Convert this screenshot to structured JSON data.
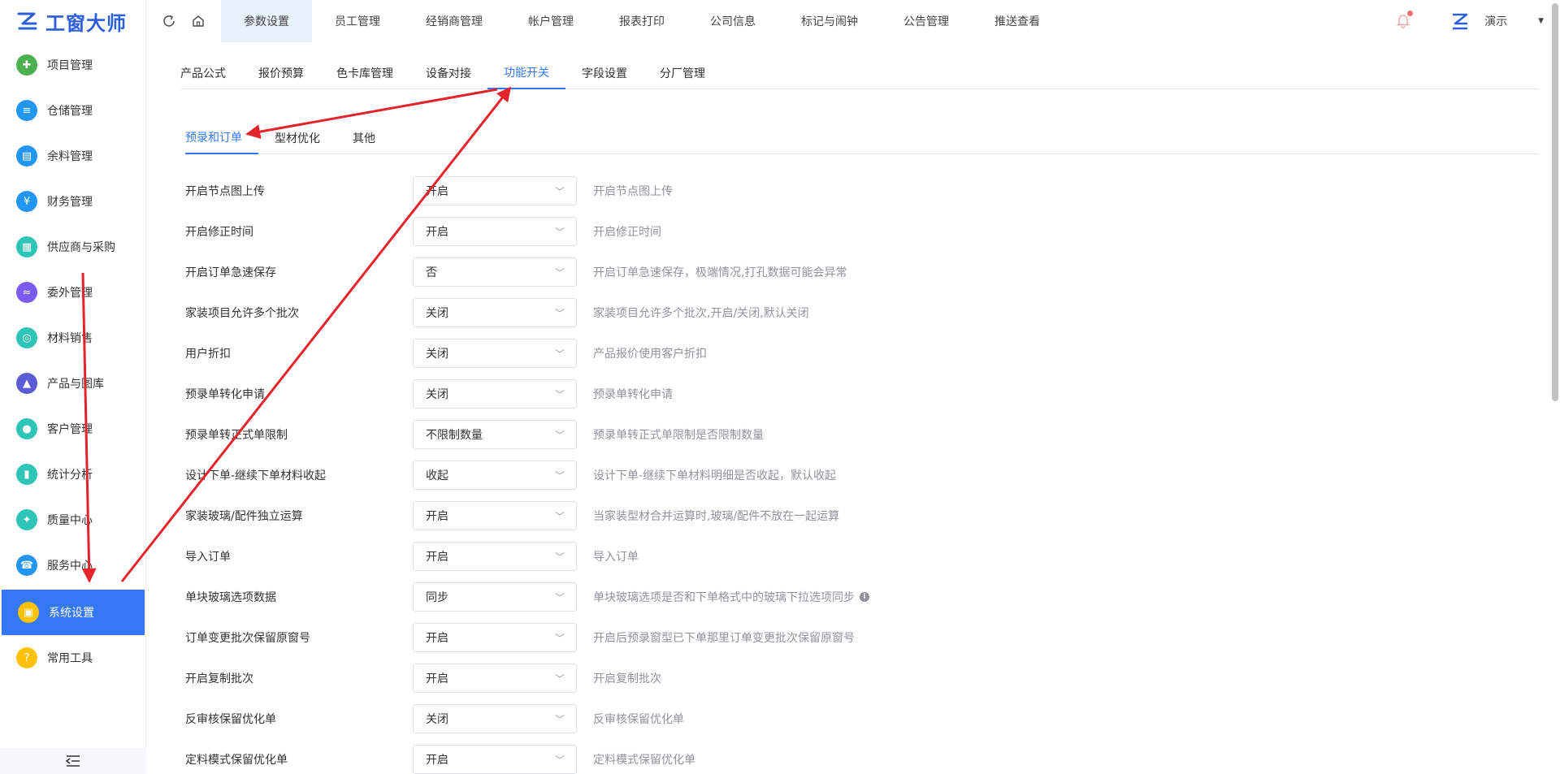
{
  "app": {
    "logo_text": "工窗大师"
  },
  "sidebar": {
    "items": [
      {
        "label": "项目管理",
        "icon": "puzzle-icon",
        "color": "#4caf50"
      },
      {
        "label": "仓储管理",
        "icon": "layers-icon",
        "color": "#2196f3"
      },
      {
        "label": "余料管理",
        "icon": "box-icon",
        "color": "#2196f3"
      },
      {
        "label": "财务管理",
        "icon": "finance-icon",
        "color": "#2196f3"
      },
      {
        "label": "供应商与采购",
        "icon": "document-icon",
        "color": "#2ec4b6"
      },
      {
        "label": "委外管理",
        "icon": "outsource-icon",
        "color": "#7c5cf0"
      },
      {
        "label": "材料销售",
        "icon": "sales-icon",
        "color": "#2ec4b6"
      },
      {
        "label": "产品与图库",
        "icon": "products-icon",
        "color": "#5b5bd6"
      },
      {
        "label": "客户管理",
        "icon": "user-icon",
        "color": "#2ec4b6"
      },
      {
        "label": "统计分析",
        "icon": "chart-icon",
        "color": "#2ec4b6"
      },
      {
        "label": "质量中心",
        "icon": "quality-icon",
        "color": "#2ec4b6"
      },
      {
        "label": "服务中心",
        "icon": "phone-icon",
        "color": "#2196f3"
      },
      {
        "label": "系统设置",
        "icon": "settings-icon",
        "color": "#ffc107",
        "active": true
      },
      {
        "label": "常用工具",
        "icon": "tools-icon",
        "color": "#ffc107"
      }
    ]
  },
  "topbar": {
    "tabs": [
      "参数设置",
      "员工管理",
      "经销商管理",
      "帐户管理",
      "报表打印",
      "公司信息",
      "标记与闹钟",
      "公告管理",
      "推送查看"
    ],
    "active_index": 0,
    "user_name": "演示"
  },
  "subtabs": {
    "items": [
      "产品公式",
      "报价预算",
      "色卡库管理",
      "设备对接",
      "功能开关",
      "字段设置",
      "分厂管理"
    ],
    "active_index": 4
  },
  "innertabs": {
    "items": [
      "预录和订单",
      "型材优化",
      "其他"
    ],
    "active_index": 0
  },
  "settings": [
    {
      "label": "开启节点图上传",
      "value": "开启",
      "desc": "开启节点图上传"
    },
    {
      "label": "开启修正时间",
      "value": "开启",
      "desc": "开启修正时间"
    },
    {
      "label": "开启订单急速保存",
      "value": "否",
      "desc": "开启订单急速保存，极端情况,打孔数据可能会异常"
    },
    {
      "label": "家装项目允许多个批次",
      "value": "关闭",
      "desc": "家装项目允许多个批次,开启/关闭,默认关闭"
    },
    {
      "label": "用户折扣",
      "value": "关闭",
      "desc": "产品报价使用客户折扣"
    },
    {
      "label": "预录单转化申请",
      "value": "关闭",
      "desc": "预录单转化申请"
    },
    {
      "label": "预录单转正式单限制",
      "value": "不限制数量",
      "desc": "预录单转正式单限制是否限制数量"
    },
    {
      "label": "设计下单-继续下单材料收起",
      "value": "收起",
      "desc": "设计下单-继续下单材料明细是否收起，默认收起"
    },
    {
      "label": "家装玻璃/配件独立运算",
      "value": "开启",
      "desc": "当家装型材合并运算时,玻璃/配件不放在一起运算"
    },
    {
      "label": "导入订单",
      "value": "开启",
      "desc": "导入订单"
    },
    {
      "label": "单块玻璃选项数据",
      "value": "同步",
      "desc": "单块玻璃选项是否和下单格式中的玻璃下拉选项同步",
      "info": true
    },
    {
      "label": "订单变更批次保留原窗号",
      "value": "开启",
      "desc": "开启后预录窗型已下单那里订单变更批次保留原窗号"
    },
    {
      "label": "开启复制批次",
      "value": "开启",
      "desc": "开启复制批次"
    },
    {
      "label": "反审核保留优化单",
      "value": "关闭",
      "desc": "反审核保留优化单"
    },
    {
      "label": "定料模式保留优化单",
      "value": "开启",
      "desc": "定料模式保留优化单"
    }
  ],
  "colors": {
    "accent": "#3478f6",
    "annotation": "#e3242b"
  }
}
